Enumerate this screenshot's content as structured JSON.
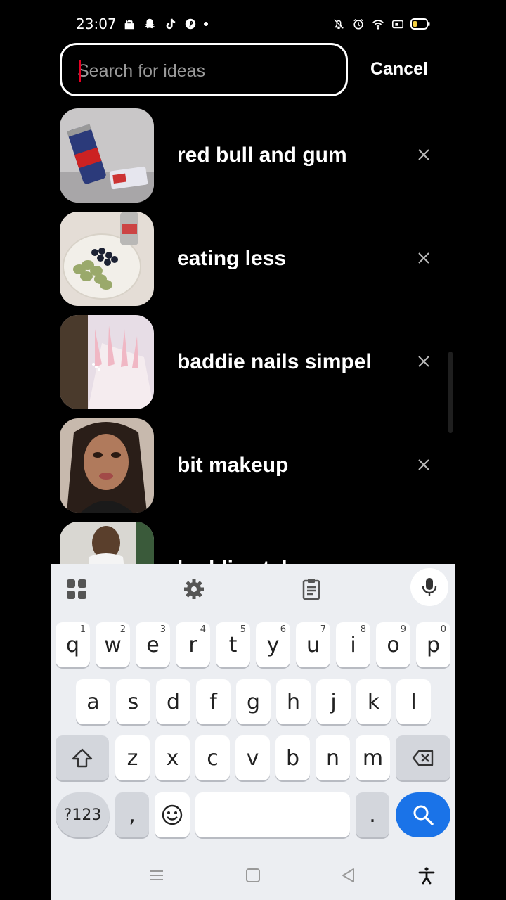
{
  "status_bar": {
    "time": "23:07",
    "left_icons": [
      "mosque-icon",
      "snapchat-icon",
      "tiktok-icon",
      "pinterest-icon",
      "dot-icon"
    ],
    "right_icons": [
      "mute-icon",
      "alarm-icon",
      "wifi-icon",
      "sim-icon",
      "battery-icon"
    ]
  },
  "search": {
    "placeholder": "Search for ideas",
    "value": "",
    "cancel_label": "Cancel"
  },
  "recent_searches": [
    {
      "label": "red bull and gum",
      "thumb": "red-bull-cans-photo"
    },
    {
      "label": "eating less",
      "thumb": "plate-cucumber-blueberries-photo"
    },
    {
      "label": "baddie nails simpel",
      "thumb": "pink-nails-photo"
    },
    {
      "label": "bit makeup",
      "thumb": "makeup-selfie-photo"
    },
    {
      "label": "baddie style",
      "thumb": "girl-white-outfit-photo"
    }
  ],
  "keyboard": {
    "toolbar": [
      "apps-grid-icon",
      "settings-gear-icon",
      "clipboard-icon",
      "microphone-icon"
    ],
    "row1": [
      {
        "k": "q",
        "h": "1"
      },
      {
        "k": "w",
        "h": "2"
      },
      {
        "k": "e",
        "h": "3"
      },
      {
        "k": "r",
        "h": "4"
      },
      {
        "k": "t",
        "h": "5"
      },
      {
        "k": "y",
        "h": "6"
      },
      {
        "k": "u",
        "h": "7"
      },
      {
        "k": "i",
        "h": "8"
      },
      {
        "k": "o",
        "h": "9"
      },
      {
        "k": "p",
        "h": "0"
      }
    ],
    "row2": [
      "a",
      "s",
      "d",
      "f",
      "g",
      "h",
      "j",
      "k",
      "l"
    ],
    "row3": [
      "z",
      "x",
      "c",
      "v",
      "b",
      "n",
      "m"
    ],
    "symbols_label": "?123",
    "comma": ",",
    "period": "."
  },
  "nav_bar": [
    "menu-icon",
    "home-square-icon",
    "back-triangle-icon",
    "accessibility-icon"
  ],
  "colors": {
    "background": "#000000",
    "accent": "#e60023",
    "search_key": "#1a73e8",
    "keyboard_bg": "#eceef2"
  }
}
